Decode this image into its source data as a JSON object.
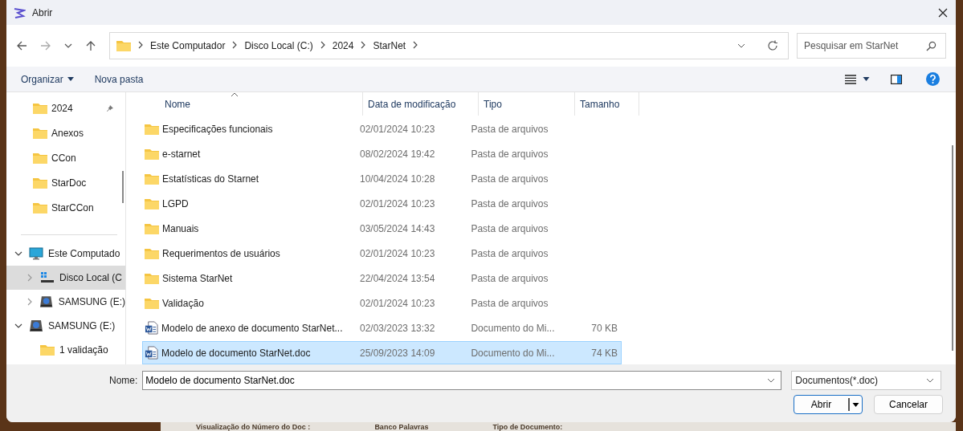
{
  "window": {
    "title": "Abrir"
  },
  "address": {
    "crumbs": [
      "Este Computador",
      "Disco Local (C:)",
      "2024",
      "StarNet"
    ]
  },
  "search": {
    "placeholder": "Pesquisar em StarNet"
  },
  "toolbar": {
    "organize": "Organizar",
    "new_folder": "Nova pasta"
  },
  "quick_access": [
    {
      "label": "2024",
      "pinned": true
    },
    {
      "label": "Anexos",
      "pinned": false
    },
    {
      "label": "CCon",
      "pinned": false
    },
    {
      "label": "StarDoc",
      "pinned": false
    },
    {
      "label": "StarCCon",
      "pinned": false
    }
  ],
  "nav_tree": [
    {
      "label": "Este Computado",
      "kind": "computer",
      "expanded": true,
      "selected": false,
      "children": [
        {
          "label": "Disco Local (C",
          "kind": "drive",
          "expanded": false,
          "selected": true
        },
        {
          "label": "SAMSUNG (E:)",
          "kind": "usb",
          "expanded": false,
          "selected": false
        }
      ]
    },
    {
      "label": "SAMSUNG (E:)",
      "kind": "usb",
      "expanded": true,
      "selected": false,
      "children": [
        {
          "label": "1 validação",
          "kind": "folder",
          "selected": false
        }
      ]
    }
  ],
  "table": {
    "columns": [
      "Nome",
      "Data de modificação",
      "Tipo",
      "Tamanho"
    ],
    "rows": [
      {
        "name": "Especificações funcionais",
        "date": "02/01/2024 10:23",
        "type": "Pasta de arquivos",
        "kind": "folder",
        "selected": false
      },
      {
        "name": "e-starnet",
        "date": "08/02/2024 19:42",
        "type": "Pasta de arquivos",
        "kind": "folder",
        "selected": false
      },
      {
        "name": "Estatísticas do Starnet",
        "date": "10/04/2024 10:28",
        "type": "Pasta de arquivos",
        "kind": "folder",
        "selected": false
      },
      {
        "name": "LGPD",
        "date": "02/01/2024 10:23",
        "type": "Pasta de arquivos",
        "kind": "folder",
        "selected": false
      },
      {
        "name": "Manuais",
        "date": "03/05/2024 14:43",
        "type": "Pasta de arquivos",
        "kind": "folder",
        "selected": false
      },
      {
        "name": "Requerimentos de usuários",
        "date": "02/01/2024 10:23",
        "type": "Pasta de arquivos",
        "kind": "folder",
        "selected": false
      },
      {
        "name": "Sistema StarNet",
        "date": "22/04/2024 13:54",
        "type": "Pasta de arquivos",
        "kind": "folder",
        "selected": false
      },
      {
        "name": "Validação",
        "date": "02/01/2024 10:23",
        "type": "Pasta de arquivos",
        "kind": "folder",
        "selected": false
      },
      {
        "name": "Modelo de anexo de documento StarNet...",
        "date": "02/03/2023 13:32",
        "type": "Documento do Mi...",
        "size": "70 KB",
        "kind": "doc",
        "selected": false
      },
      {
        "name": "Modelo de documento StarNet.doc",
        "date": "25/09/2023 14:09",
        "type": "Documento do Mi...",
        "size": "74 KB",
        "kind": "doc",
        "selected": true
      }
    ]
  },
  "file_name": {
    "label": "Nome:",
    "value": "Modelo de documento StarNet.doc"
  },
  "file_type": {
    "value": "Documentos(*.doc)"
  },
  "buttons": {
    "open": "Abrir",
    "cancel": "Cancelar"
  },
  "background": {
    "labels": [
      "Visualização do Número do Doc :",
      "Banco Palavras",
      "Tipo de Documento:"
    ]
  }
}
